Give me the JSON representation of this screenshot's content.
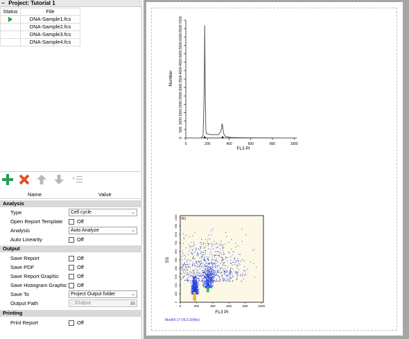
{
  "project": {
    "title": "Project:  Tutorial 1",
    "columns": {
      "status": "Status",
      "file": "File"
    },
    "files": [
      {
        "name": "DNA-Sample1.fcs",
        "active": true
      },
      {
        "name": "DNA-Sample2.fcs",
        "active": false
      },
      {
        "name": "DNA-Sample3.fcs",
        "active": false
      },
      {
        "name": "DNA-Sample4.fcs",
        "active": false
      }
    ]
  },
  "toolbar": {
    "add_icon": "plus-icon",
    "remove_icon": "x-icon",
    "up_icon": "arrow-up-icon",
    "down_icon": "arrow-down-icon",
    "list_icon": "list-indent-icon"
  },
  "properties": {
    "columns": {
      "name": "Name",
      "value": "Value"
    },
    "analysis": {
      "section": "Analysis",
      "type_label": "Type",
      "type_value": "Cell cycle",
      "template_label": "Open Report Template",
      "template_value": "Off",
      "analysis_label": "Analysis",
      "analysis_value": "Auto Analyze",
      "linearity_label": "Auto Linearity",
      "linearity_value": "Off"
    },
    "output": {
      "section": "Output",
      "save_report_label": "Save Report",
      "save_report_value": "Off",
      "save_pdf_label": "Save PDF",
      "save_pdf_value": "Off",
      "save_report_graphic_label": "Save Report Graphic",
      "save_report_graphic_value": "Off",
      "save_hist_label": "Save Histogram Graphic",
      "save_hist_value": "Off",
      "save_to_label": "Save To",
      "save_to_value": "Project Output folder",
      "path_label": "Output Path",
      "path_value": "...\\Output"
    },
    "printing": {
      "section": "Printing",
      "print_label": "Print Report",
      "print_value": "Off"
    }
  },
  "report": {
    "histogram": {
      "ylabel": "Number",
      "xlabel": "FL3 PI",
      "yticks": [
        "0",
        "500",
        "1000",
        "1500",
        "2000",
        "2500",
        "3000",
        "3500",
        "4000",
        "4500",
        "5000",
        "5500",
        "6000",
        "6500",
        "7000"
      ],
      "xticks": [
        "0",
        "200",
        "400",
        "600",
        "800",
        "1000"
      ]
    },
    "scatter": {
      "ylabel": "SS",
      "xlabel": "FL3 PI",
      "region": "R1",
      "yticks": [
        "0",
        "100",
        "200",
        "300",
        "400",
        "500",
        "600",
        "700",
        "800",
        "900",
        "1000"
      ],
      "xticks": [
        "0",
        "200",
        "400",
        "600",
        "800",
        "1000"
      ]
    },
    "footer": "ModFit LT V6.0.2(Win)"
  },
  "chart_data": [
    {
      "type": "line",
      "xlabel": "FL3 PI",
      "ylabel": "Number",
      "xlim": [
        0,
        1024
      ],
      "ylim": [
        0,
        7000
      ],
      "x": [
        0,
        140,
        160,
        170,
        175,
        180,
        185,
        190,
        200,
        220,
        250,
        280,
        300,
        320,
        330,
        335,
        340,
        345,
        350,
        360,
        380,
        420,
        500,
        600,
        700,
        800,
        900,
        1000
      ],
      "y": [
        0,
        0,
        150,
        2800,
        6700,
        2800,
        500,
        250,
        250,
        200,
        200,
        200,
        200,
        350,
        550,
        850,
        750,
        450,
        250,
        120,
        60,
        30,
        15,
        8,
        5,
        3,
        2,
        0
      ],
      "markers": [
        175,
        340
      ]
    },
    {
      "type": "scatter",
      "xlabel": "FL3 PI",
      "ylabel": "SS",
      "xlim": [
        0,
        1024
      ],
      "ylim": [
        0,
        1024
      ],
      "clusters": [
        {
          "center": [
            175,
            160
          ],
          "spread": [
            18,
            110
          ],
          "count": 600
        },
        {
          "center": [
            340,
            230
          ],
          "spread": [
            30,
            160
          ],
          "count": 350
        },
        {
          "center": [
            350,
            400
          ],
          "spread": [
            230,
            230
          ],
          "count": 750
        }
      ]
    }
  ]
}
